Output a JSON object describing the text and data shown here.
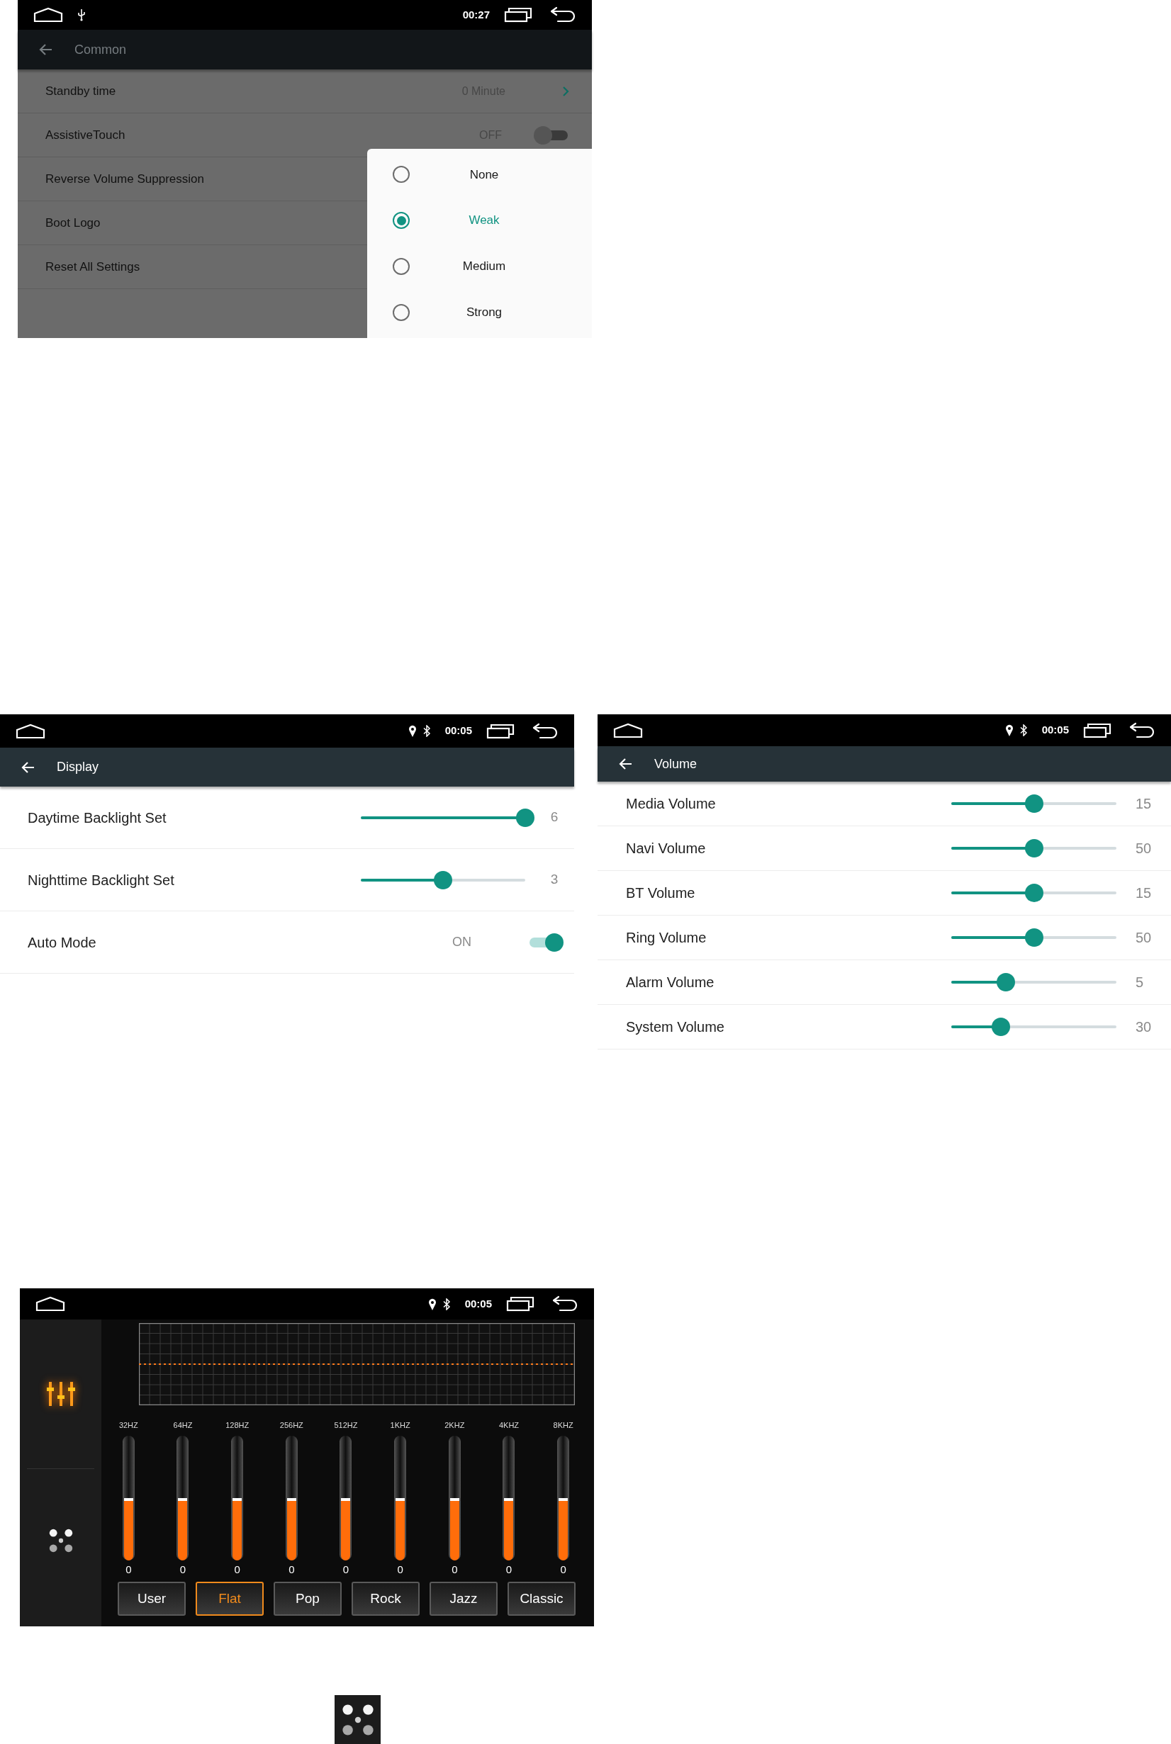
{
  "common_screen": {
    "status_bar": {
      "time": "00:27"
    },
    "title": "Common",
    "rows": [
      {
        "kind": "link",
        "label": "Standby time",
        "value": "0 Minute"
      },
      {
        "kind": "toggle",
        "label": "AssistiveTouch",
        "value": "OFF",
        "on": false
      },
      {
        "kind": "plain",
        "label": "Reverse Volume Suppression"
      },
      {
        "kind": "plain",
        "label": "Boot Logo"
      },
      {
        "kind": "plain",
        "label": "Reset All Settings"
      }
    ],
    "dialog": {
      "options": [
        {
          "label": "None",
          "selected": false
        },
        {
          "label": "Weak",
          "selected": true
        },
        {
          "label": "Medium",
          "selected": false
        },
        {
          "label": "Strong",
          "selected": false
        }
      ]
    }
  },
  "display_screen": {
    "status_bar": {
      "time": "00:05"
    },
    "title": "Display",
    "rows": [
      {
        "kind": "slider",
        "label": "Daytime Backlight Set",
        "level": 1,
        "reading": "6"
      },
      {
        "kind": "slider",
        "label": "Nighttime Backlight Set",
        "level": 0.5,
        "reading": "3"
      },
      {
        "kind": "toggle",
        "label": "Auto Mode",
        "reading": "ON",
        "on": true
      }
    ]
  },
  "volume_screen": {
    "status_bar": {
      "time": "00:05"
    },
    "title": "Volume",
    "rows": [
      {
        "label": "Media Volume",
        "level": 0.5,
        "reading": "15"
      },
      {
        "label": "Navi Volume",
        "level": 0.5,
        "reading": "50"
      },
      {
        "label": "BT Volume",
        "level": 0.5,
        "reading": "15"
      },
      {
        "label": "Ring Volume",
        "level": 0.5,
        "reading": "50"
      },
      {
        "label": "Alarm Volume",
        "level": 0.33,
        "reading": "5"
      },
      {
        "label": "System Volume",
        "level": 0.3,
        "reading": "30"
      }
    ]
  },
  "equalizer_screen": {
    "status_bar": {
      "time": "00:05"
    },
    "bands": [
      {
        "label": "32HZ",
        "level": 0.5,
        "reading": "0"
      },
      {
        "label": "64HZ",
        "level": 0.5,
        "reading": "0"
      },
      {
        "label": "128HZ",
        "level": 0.5,
        "reading": "0"
      },
      {
        "label": "256HZ",
        "level": 0.5,
        "reading": "0"
      },
      {
        "label": "512HZ",
        "level": 0.5,
        "reading": "0"
      },
      {
        "label": "1KHZ",
        "level": 0.5,
        "reading": "0"
      },
      {
        "label": "2KHZ",
        "level": 0.5,
        "reading": "0"
      },
      {
        "label": "4KHZ",
        "level": 0.5,
        "reading": "0"
      },
      {
        "label": "8KHZ",
        "level": 0.5,
        "reading": "0"
      }
    ],
    "presets": [
      {
        "label": "User",
        "selected": false
      },
      {
        "label": "Flat",
        "selected": true
      },
      {
        "label": "Pop",
        "selected": false
      },
      {
        "label": "Rock",
        "selected": false
      },
      {
        "label": "Jazz",
        "selected": false
      },
      {
        "label": "Classic",
        "selected": false
      }
    ]
  }
}
